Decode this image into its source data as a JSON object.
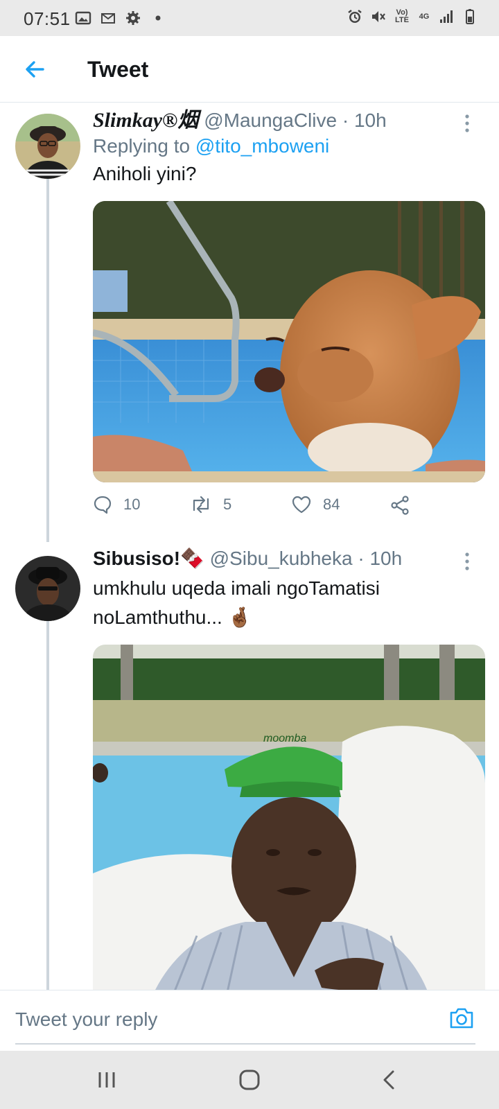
{
  "status_bar": {
    "time": "07:51",
    "left_icons": [
      "image-icon",
      "gmail-icon",
      "settings-gear-icon",
      "notification-dot-icon"
    ],
    "right_icons": [
      "alarm-icon",
      "mute-icon",
      "volte-icon",
      "4g-icon",
      "signal-icon",
      "battery-icon"
    ],
    "volte_label": "Vo) LTE",
    "network_label": "4G"
  },
  "header": {
    "title": "Tweet",
    "back_icon": "arrow-left-icon"
  },
  "colors": {
    "accent": "#1da1f2",
    "secondary_text": "#657786",
    "primary_text": "#14171a",
    "divider": "#e1e8ed"
  },
  "tweets": [
    {
      "display_name": "Slimkay®烟",
      "handle": "@MaungaClive",
      "separator": "·",
      "time": "10h",
      "replying_prefix": "Replying to",
      "replying_to": "@tito_mboweni",
      "text": "Aniholi yini?",
      "media_description_icon": "chihuahua-pool-photo",
      "actions": {
        "replies": "10",
        "retweets": "5",
        "likes": "84"
      }
    },
    {
      "display_name": "Sibusiso!🍫",
      "handle": "@Sibu_kubheka",
      "separator": "·",
      "time": "10h",
      "text": "umkhulu uqeda imali ngoTamatisi noLamthuthu... 🤞🏾",
      "media_description_icon": "man-green-cap-pool-photo"
    }
  ],
  "reply_bar": {
    "placeholder": "Tweet your reply",
    "camera_icon": "camera-icon"
  },
  "nav_bar": {
    "icons": [
      "recent-apps-icon",
      "home-icon",
      "back-icon"
    ]
  }
}
